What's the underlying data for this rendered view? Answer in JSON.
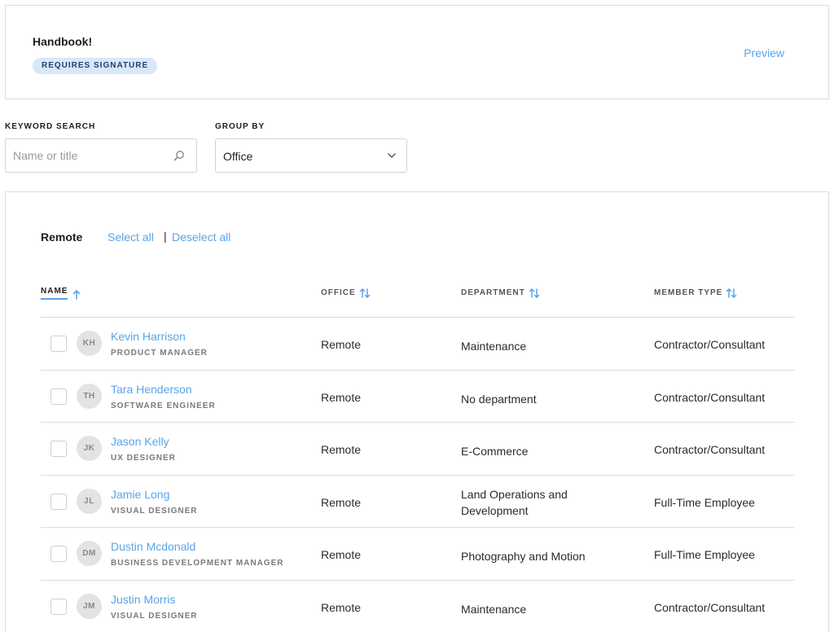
{
  "document": {
    "title": "Handbook!",
    "badge": "REQUIRES SIGNATURE",
    "preview_label": "Preview"
  },
  "filters": {
    "keyword_label": "KEYWORD SEARCH",
    "keyword_placeholder": "Name or title",
    "keyword_value": "",
    "group_by_label": "GROUP BY",
    "group_by_value": "Office"
  },
  "group": {
    "name": "Remote",
    "select_all": "Select all",
    "divider": "|",
    "deselect_all": "Deselect all"
  },
  "columns": [
    {
      "label": "NAME",
      "sort_icon": "arrow-up-icon"
    },
    {
      "label": "OFFICE",
      "sort_icon": "sort-icon"
    },
    {
      "label": "DEPARTMENT",
      "sort_icon": "sort-icon"
    },
    {
      "label": "MEMBER TYPE",
      "sort_icon": "sort-icon"
    }
  ],
  "rows": [
    {
      "initials": "KH",
      "name": "Kevin Harrison",
      "title": "PRODUCT MANAGER",
      "office": "Remote",
      "department": "Maintenance",
      "member_type": "Contractor/Consultant",
      "checked": false
    },
    {
      "initials": "TH",
      "name": "Tara Henderson",
      "title": "SOFTWARE ENGINEER",
      "office": "Remote",
      "department": "No department",
      "member_type": "Contractor/Consultant",
      "checked": false
    },
    {
      "initials": "JK",
      "name": "Jason Kelly",
      "title": "UX DESIGNER",
      "office": "Remote",
      "department": "E-Commerce",
      "member_type": "Contractor/Consultant",
      "checked": false
    },
    {
      "initials": "JL",
      "name": "Jamie Long",
      "title": "VISUAL DESIGNER",
      "office": "Remote",
      "department": "Land Operations and Development",
      "member_type": "Full-Time Employee",
      "checked": false
    },
    {
      "initials": "DM",
      "name": "Dustin Mcdonald",
      "title": "BUSINESS DEVELOPMENT MANAGER",
      "office": "Remote",
      "department": "Photography and Motion",
      "member_type": "Full-Time Employee",
      "checked": false
    },
    {
      "initials": "JM",
      "name": "Justin Morris",
      "title": "VISUAL DESIGNER",
      "office": "Remote",
      "department": "Maintenance",
      "member_type": "Contractor/Consultant",
      "checked": false
    }
  ],
  "colors": {
    "accent": "#5aa4e8",
    "badge_bg": "#d6e8fa",
    "border": "#dcdcdc"
  }
}
